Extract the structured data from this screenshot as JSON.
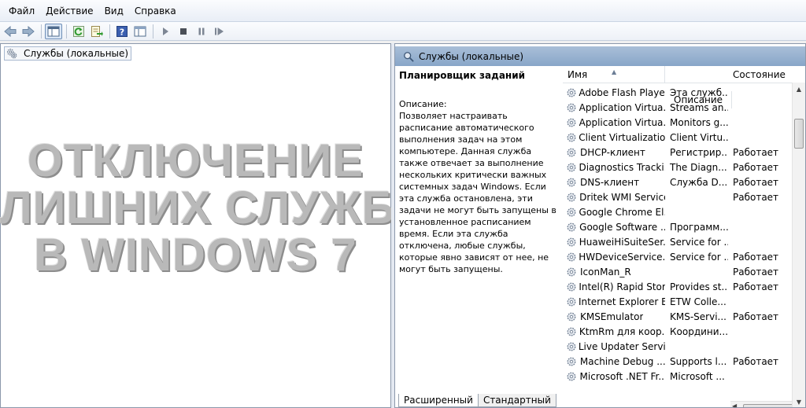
{
  "menu": [
    "Файл",
    "Действие",
    "Вид",
    "Справка"
  ],
  "toolbar": {
    "icons": [
      "back-arrow-icon",
      "forward-arrow-icon",
      "show-hide-console-tree-icon",
      "refresh-icon",
      "export-list-icon",
      "help-icon",
      "properties-icon",
      "start-service-icon",
      "stop-service-icon",
      "pause-service-icon",
      "restart-service-icon"
    ]
  },
  "tree": {
    "root_label": "Службы (локальные)"
  },
  "overlay": {
    "lines": [
      "ОТКЛЮЧЕНИЕ",
      "ЛИШНИХ СЛУЖБ",
      "В WINDOWS 7"
    ]
  },
  "right_pane": {
    "header_title": "Службы (локальные)",
    "selected_service": "Планировщик заданий",
    "description_label": "Описание:",
    "description_text": "Позволяет настраивать расписание автоматического выполнения задач на этом компьютере. Данная служба также отвечает за выполнение нескольких критически важных системных задач Windows. Если эта служба остановлена, эти задачи не могут быть запущены в установленное расписанием время. Если эта служба отключена, любые службы, которые явно зависят от нее, не могут быть запущены."
  },
  "columns": {
    "name": "Имя",
    "description": "Описание",
    "state": "Состояние"
  },
  "services": [
    {
      "name": "Adobe Flash Playe...",
      "description": "Эта служб...",
      "state": ""
    },
    {
      "name": "Application Virtua...",
      "description": "Streams an...",
      "state": ""
    },
    {
      "name": "Application Virtua...",
      "description": "Monitors g...",
      "state": ""
    },
    {
      "name": "Client Virtualizatio...",
      "description": "Client Virtu...",
      "state": ""
    },
    {
      "name": "DHCP-клиент",
      "description": "Регистрир...",
      "state": "Работает"
    },
    {
      "name": "Diagnostics Tracki...",
      "description": "The Diagn...",
      "state": "Работает"
    },
    {
      "name": "DNS-клиент",
      "description": "Служба D...",
      "state": "Работает"
    },
    {
      "name": "Dritek WMI Service",
      "description": "",
      "state": "Работает"
    },
    {
      "name": "Google Chrome El...",
      "description": "",
      "state": ""
    },
    {
      "name": "Google Software ...",
      "description": "Программ...",
      "state": ""
    },
    {
      "name": "HuaweiHiSuiteSer...",
      "description": "Service for ...",
      "state": ""
    },
    {
      "name": "HWDeviceService....",
      "description": "Service for ...",
      "state": "Работает"
    },
    {
      "name": "IconMan_R",
      "description": "",
      "state": "Работает"
    },
    {
      "name": "Intel(R) Rapid Stor...",
      "description": "Provides st...",
      "state": "Работает"
    },
    {
      "name": "Internet Explorer E...",
      "description": "ETW Colle...",
      "state": ""
    },
    {
      "name": "KMSEmulator",
      "description": "KMS-Servi...",
      "state": "Работает"
    },
    {
      "name": "KtmRm для коор...",
      "description": "Координи...",
      "state": ""
    },
    {
      "name": "Live Updater Service",
      "description": "",
      "state": ""
    },
    {
      "name": "Machine Debug ...",
      "description": "Supports l...",
      "state": "Работает"
    },
    {
      "name": "Microsoft .NET Fr...",
      "description": "Microsoft ...",
      "state": ""
    }
  ],
  "tabs": {
    "extended": "Расширенный",
    "standard": "Стандартный"
  }
}
